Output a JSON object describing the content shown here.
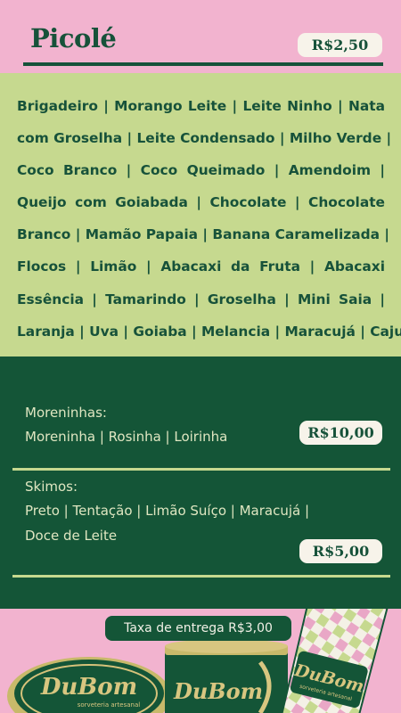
{
  "header": {
    "title": "Picolé",
    "price": "R$2,50"
  },
  "flavors": {
    "lines": [
      "Brigadeiro | Morango Leite | Leite Ninho | Nata",
      "com Groselha | Leite Condensado | Milho Verde |",
      "Coco Branco | Coco Queimado | Amendoim |",
      "Queijo com Goiabada | Chocolate | Chocolate",
      "Branco | Mamão Papaia | Banana Caramelizada |",
      "Flocos | Limão | Abacaxi da Fruta | Abacaxi",
      "Essência | Tamarindo | Groselha | Mini Saia |",
      "Laranja | Uva | Goiaba | Melancia | Maracujá | Caju"
    ]
  },
  "moreninhas": {
    "label": "Moreninhas:",
    "items": "Moreninha | Rosinha | Loirinha",
    "price": "R$10,00"
  },
  "skimos": {
    "label": "Skimos:",
    "items_line1": "Preto | Tentação | Limão Suíço | Maracujá |",
    "items_line2": "Doce de Leite",
    "price": "R$5,00"
  },
  "footer": {
    "delivery": "Taxa de entrega R$3,00",
    "brand": "DuBom",
    "brand_sub": "sorveteria artesanal",
    "brand_sub_short": "sorveteria"
  },
  "colors": {
    "pink": "#f2b3cf",
    "lime": "#c6d98f",
    "green": "#145537",
    "cream": "#f7f3ea"
  }
}
